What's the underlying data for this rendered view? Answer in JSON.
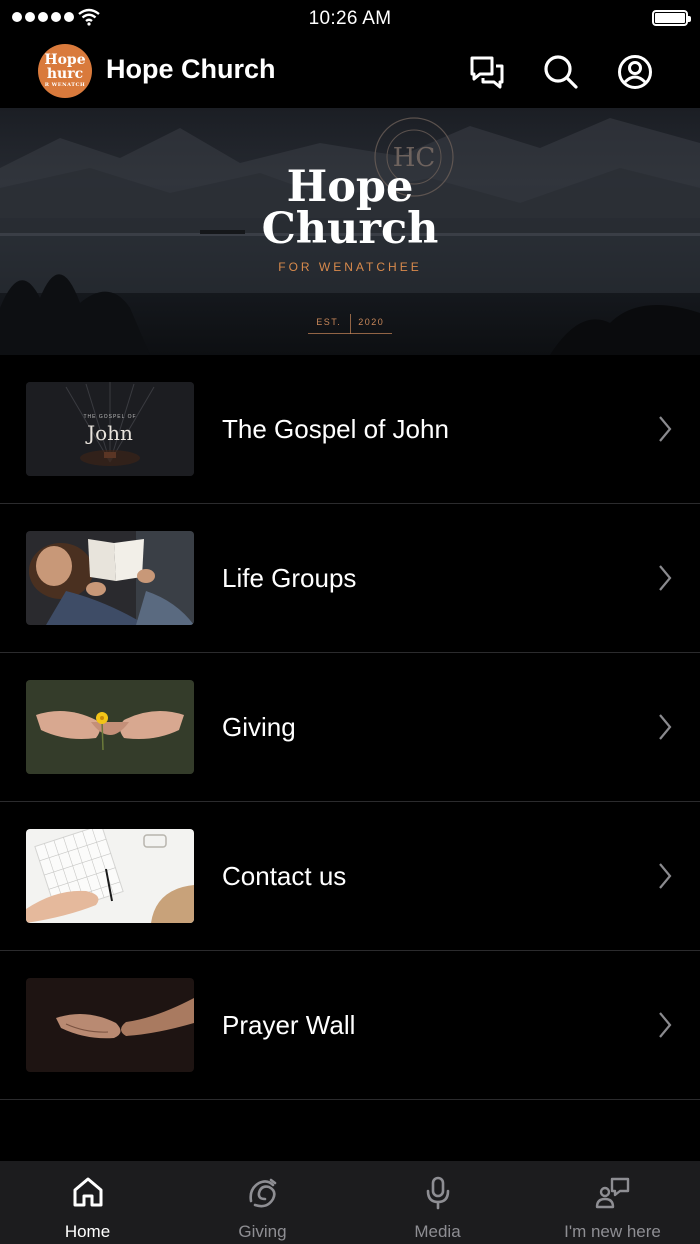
{
  "status_bar": {
    "time": "10:26 AM"
  },
  "header": {
    "logo_text_line1": "Hope",
    "logo_text_line2": "hurc",
    "logo_text_line3": "R WENATCH",
    "title": "Hope Church",
    "icons": [
      "chat-icon",
      "search-icon",
      "profile-icon"
    ]
  },
  "hero": {
    "title_line1": "Hope",
    "title_line2": "Church",
    "subtitle": "FOR WENATCHEE",
    "est_label": "EST.",
    "est_year": "2020",
    "seal_text": "HOPE CHURCH FOR WENATCHEE",
    "seal_monogram": "HC"
  },
  "list": {
    "items": [
      {
        "label": "The Gospel of John",
        "thumb_small": "THE GOSPEL OF",
        "thumb_big": "John"
      },
      {
        "label": "Life Groups"
      },
      {
        "label": "Giving"
      },
      {
        "label": "Contact us"
      },
      {
        "label": "Prayer Wall"
      }
    ]
  },
  "tabbar": {
    "tabs": [
      {
        "label": "Home",
        "icon": "home-icon",
        "active": true
      },
      {
        "label": "Giving",
        "icon": "giving-icon",
        "active": false
      },
      {
        "label": "Media",
        "icon": "microphone-icon",
        "active": false
      },
      {
        "label": "I'm new here",
        "icon": "new-person-icon",
        "active": false
      }
    ]
  },
  "colors": {
    "accent": "#d97a3c",
    "background": "#000000",
    "tabbar": "#1c1c1e",
    "inactive": "#8e8e93"
  }
}
